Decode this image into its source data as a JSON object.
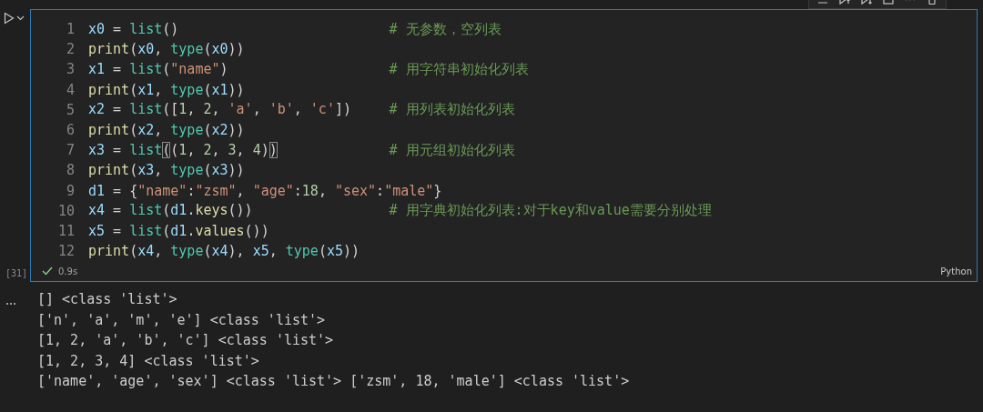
{
  "cell": {
    "execution_count": "[31]",
    "succeeded": true,
    "duration": "0.9s",
    "language": "Python",
    "lines": [
      {
        "number": "1",
        "tokens": [
          {
            "kind": "var",
            "text": "x0"
          },
          {
            "kind": "punct",
            "text": " = "
          },
          {
            "kind": "cls",
            "text": "list"
          },
          {
            "kind": "punct",
            "text": "()"
          }
        ],
        "comment": "# 无参数，空列表"
      },
      {
        "number": "2",
        "tokens": [
          {
            "kind": "fn",
            "text": "print"
          },
          {
            "kind": "punct",
            "text": "("
          },
          {
            "kind": "var",
            "text": "x0"
          },
          {
            "kind": "punct",
            "text": ", "
          },
          {
            "kind": "cls",
            "text": "type"
          },
          {
            "kind": "punct",
            "text": "("
          },
          {
            "kind": "var",
            "text": "x0"
          },
          {
            "kind": "punct",
            "text": "))"
          }
        ]
      },
      {
        "number": "3",
        "tokens": [
          {
            "kind": "var",
            "text": "x1"
          },
          {
            "kind": "punct",
            "text": " = "
          },
          {
            "kind": "cls",
            "text": "list"
          },
          {
            "kind": "punct",
            "text": "("
          },
          {
            "kind": "str",
            "text": "\"name\""
          },
          {
            "kind": "punct",
            "text": ")"
          }
        ],
        "comment": "# 用字符串初始化列表"
      },
      {
        "number": "4",
        "tokens": [
          {
            "kind": "fn",
            "text": "print"
          },
          {
            "kind": "punct",
            "text": "("
          },
          {
            "kind": "var",
            "text": "x1"
          },
          {
            "kind": "punct",
            "text": ", "
          },
          {
            "kind": "cls",
            "text": "type"
          },
          {
            "kind": "punct",
            "text": "("
          },
          {
            "kind": "var",
            "text": "x1"
          },
          {
            "kind": "punct",
            "text": "))"
          }
        ]
      },
      {
        "number": "5",
        "tokens": [
          {
            "kind": "var",
            "text": "x2"
          },
          {
            "kind": "punct",
            "text": " = "
          },
          {
            "kind": "cls",
            "text": "list"
          },
          {
            "kind": "punct",
            "text": "(["
          },
          {
            "kind": "num",
            "text": "1"
          },
          {
            "kind": "punct",
            "text": ", "
          },
          {
            "kind": "num",
            "text": "2"
          },
          {
            "kind": "punct",
            "text": ", "
          },
          {
            "kind": "str",
            "text": "'a'"
          },
          {
            "kind": "punct",
            "text": ", "
          },
          {
            "kind": "str",
            "text": "'b'"
          },
          {
            "kind": "punct",
            "text": ", "
          },
          {
            "kind": "str",
            "text": "'c'"
          },
          {
            "kind": "punct",
            "text": "])"
          }
        ],
        "comment": "# 用列表初始化列表"
      },
      {
        "number": "6",
        "tokens": [
          {
            "kind": "fn",
            "text": "print"
          },
          {
            "kind": "punct",
            "text": "("
          },
          {
            "kind": "var",
            "text": "x2"
          },
          {
            "kind": "punct",
            "text": ", "
          },
          {
            "kind": "cls",
            "text": "type"
          },
          {
            "kind": "punct",
            "text": "("
          },
          {
            "kind": "var",
            "text": "x2"
          },
          {
            "kind": "punct",
            "text": "))"
          }
        ]
      },
      {
        "number": "7",
        "tokens": [
          {
            "kind": "var",
            "text": "x3"
          },
          {
            "kind": "punct",
            "text": " = "
          },
          {
            "kind": "cls",
            "text": "list"
          },
          {
            "kind": "match",
            "text": "("
          },
          {
            "kind": "punct",
            "text": "("
          },
          {
            "kind": "num",
            "text": "1"
          },
          {
            "kind": "punct",
            "text": ", "
          },
          {
            "kind": "num",
            "text": "2"
          },
          {
            "kind": "punct",
            "text": ", "
          },
          {
            "kind": "num",
            "text": "3"
          },
          {
            "kind": "punct",
            "text": ", "
          },
          {
            "kind": "num",
            "text": "4"
          },
          {
            "kind": "punct",
            "text": ")"
          },
          {
            "kind": "match",
            "text": ")"
          }
        ],
        "comment": "# 用元组初始化列表"
      },
      {
        "number": "8",
        "tokens": [
          {
            "kind": "fn",
            "text": "print"
          },
          {
            "kind": "punct",
            "text": "("
          },
          {
            "kind": "var",
            "text": "x3"
          },
          {
            "kind": "punct",
            "text": ", "
          },
          {
            "kind": "cls",
            "text": "type"
          },
          {
            "kind": "punct",
            "text": "("
          },
          {
            "kind": "var",
            "text": "x3"
          },
          {
            "kind": "punct",
            "text": "))"
          }
        ]
      },
      {
        "number": "9",
        "tokens": [
          {
            "kind": "var",
            "text": "d1"
          },
          {
            "kind": "punct",
            "text": " = {"
          },
          {
            "kind": "str",
            "text": "\"name\""
          },
          {
            "kind": "punct",
            "text": ":"
          },
          {
            "kind": "str",
            "text": "\"zsm\""
          },
          {
            "kind": "punct",
            "text": ", "
          },
          {
            "kind": "str",
            "text": "\"age\""
          },
          {
            "kind": "punct",
            "text": ":"
          },
          {
            "kind": "num",
            "text": "18"
          },
          {
            "kind": "punct",
            "text": ", "
          },
          {
            "kind": "str",
            "text": "\"sex\""
          },
          {
            "kind": "punct",
            "text": ":"
          },
          {
            "kind": "str",
            "text": "\"male\""
          },
          {
            "kind": "punct",
            "text": "}"
          }
        ]
      },
      {
        "number": "10",
        "tokens": [
          {
            "kind": "var",
            "text": "x4"
          },
          {
            "kind": "punct",
            "text": " = "
          },
          {
            "kind": "cls",
            "text": "list"
          },
          {
            "kind": "punct",
            "text": "("
          },
          {
            "kind": "var",
            "text": "d1"
          },
          {
            "kind": "punct",
            "text": "."
          },
          {
            "kind": "fn",
            "text": "keys"
          },
          {
            "kind": "punct",
            "text": "())"
          }
        ],
        "comment": "# 用字典初始化列表:对于key和value需要分别处理"
      },
      {
        "number": "11",
        "tokens": [
          {
            "kind": "var",
            "text": "x5"
          },
          {
            "kind": "punct",
            "text": " = "
          },
          {
            "kind": "cls",
            "text": "list"
          },
          {
            "kind": "punct",
            "text": "("
          },
          {
            "kind": "var",
            "text": "d1"
          },
          {
            "kind": "punct",
            "text": "."
          },
          {
            "kind": "fn",
            "text": "values"
          },
          {
            "kind": "punct",
            "text": "())"
          }
        ]
      },
      {
        "number": "12",
        "tokens": [
          {
            "kind": "fn",
            "text": "print"
          },
          {
            "kind": "punct",
            "text": "("
          },
          {
            "kind": "var",
            "text": "x4"
          },
          {
            "kind": "punct",
            "text": ", "
          },
          {
            "kind": "cls",
            "text": "type"
          },
          {
            "kind": "punct",
            "text": "("
          },
          {
            "kind": "var",
            "text": "x4"
          },
          {
            "kind": "punct",
            "text": "), "
          },
          {
            "kind": "var",
            "text": "x5"
          },
          {
            "kind": "punct",
            "text": ", "
          },
          {
            "kind": "cls",
            "text": "type"
          },
          {
            "kind": "punct",
            "text": "("
          },
          {
            "kind": "var",
            "text": "x5"
          },
          {
            "kind": "punct",
            "text": "))"
          }
        ]
      }
    ]
  },
  "output": [
    "[] <class 'list'>",
    "['n', 'a', 'm', 'e'] <class 'list'>",
    "[1, 2, 'a', 'b', 'c'] <class 'list'>",
    "[1, 2, 3, 4] <class 'list'>",
    "['name', 'age', 'sex'] <class 'list'> ['zsm', 18, 'male'] <class 'list'>"
  ]
}
